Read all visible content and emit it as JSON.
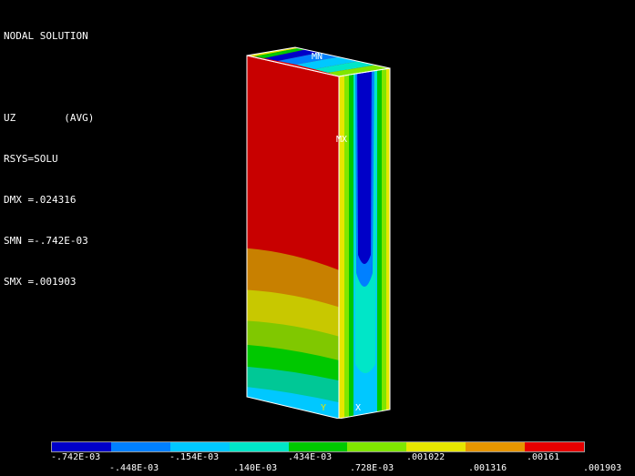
{
  "header": {
    "title": "NODAL SOLUTION",
    "result": "UZ",
    "avg": "(AVG)",
    "rsys": "RSYS=SOLU",
    "dmx": "DMX =.024316",
    "smn": "SMN =-.742E-03",
    "smx": "SMX =.001903"
  },
  "markers": {
    "min": "MN",
    "max": "MX",
    "axis_y": "Y",
    "axis_x": "X"
  },
  "legend": {
    "colors": [
      "#0000c8",
      "#0080ff",
      "#00c8ff",
      "#00e6c8",
      "#00c800",
      "#80e600",
      "#e6e600",
      "#e69600",
      "#e60000"
    ],
    "top_labels": [
      "-.742E-03",
      "-.154E-03",
      ".434E-03",
      ".001022",
      ".00161"
    ],
    "bottom_labels": [
      "-.448E-03",
      ".140E-03",
      ".728E-03",
      ".001316",
      ".001903"
    ]
  }
}
